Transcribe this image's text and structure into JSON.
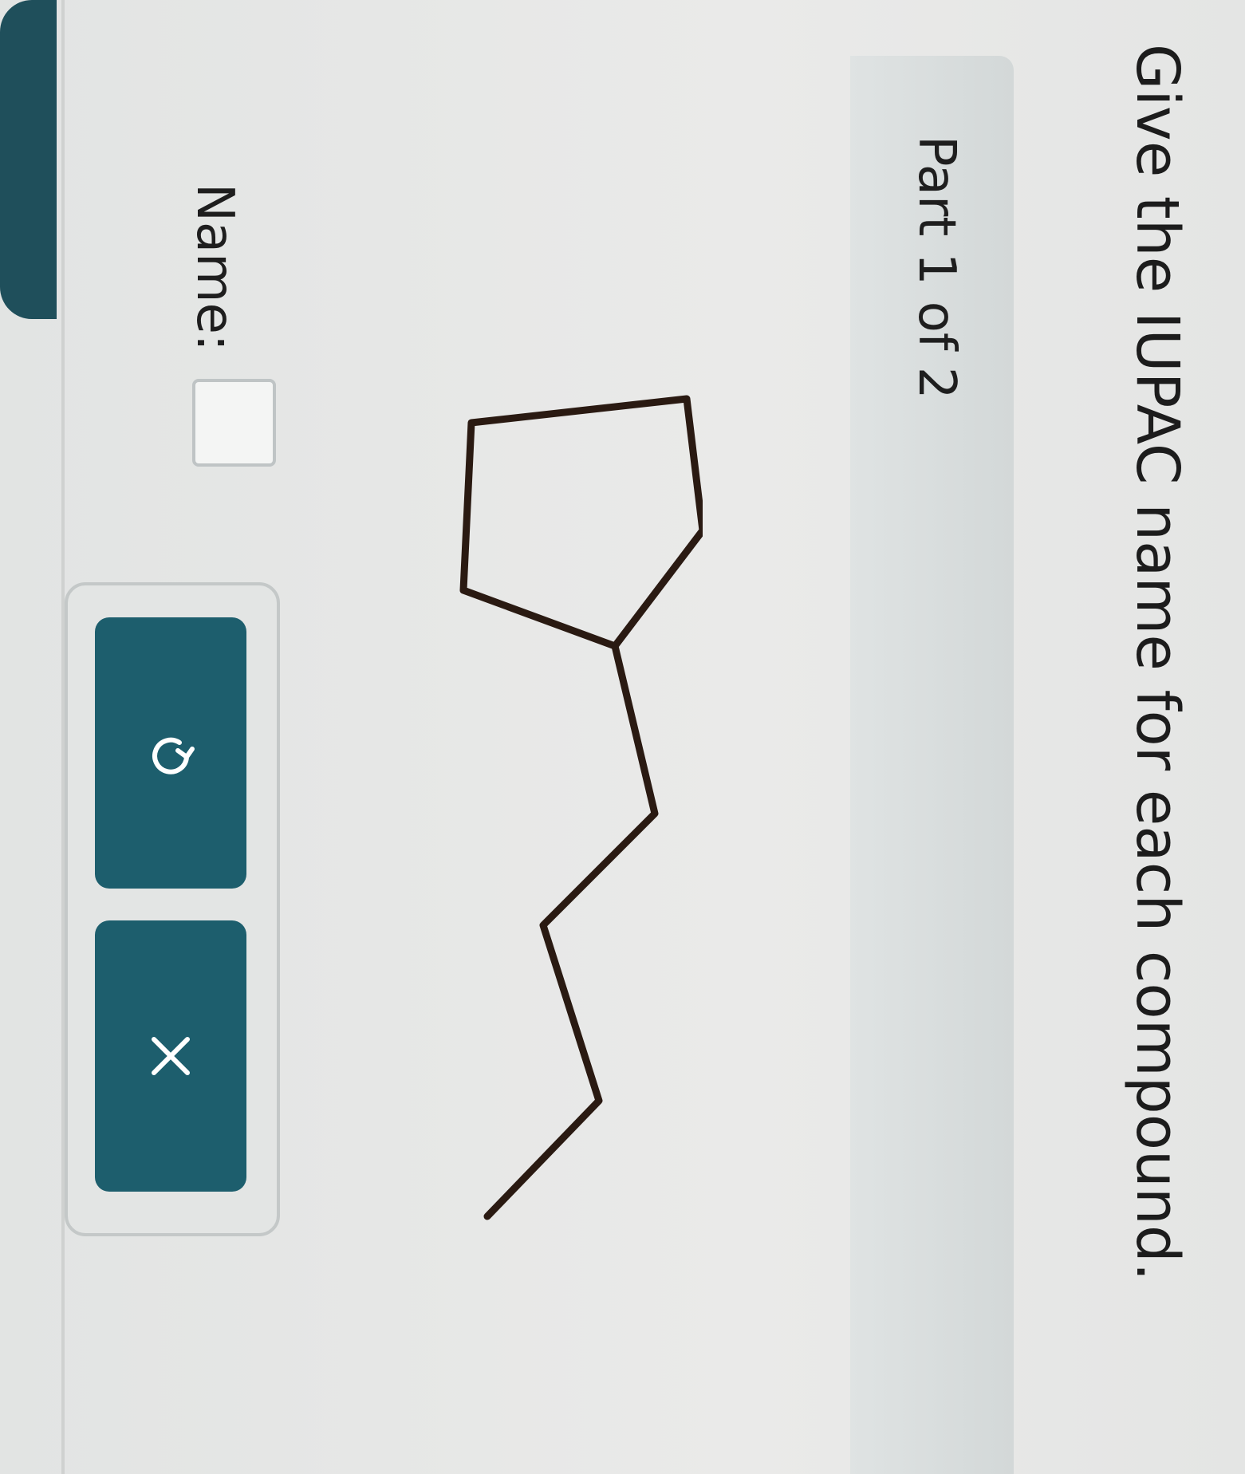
{
  "question": {
    "instruction": "Give the IUPAC name for each compound."
  },
  "part": {
    "label": "Part 1 of 2"
  },
  "molecule": {
    "description_type": "skeletal-structure",
    "bond_color": "#2a1a12"
  },
  "answer": {
    "label": "Name:",
    "value": ""
  },
  "actions": {
    "undo_icon": "undo-icon",
    "clear_icon": "close-icon"
  },
  "colors": {
    "button_bg": "#1d5e6d",
    "tab_accent": "#1f4f5b"
  }
}
